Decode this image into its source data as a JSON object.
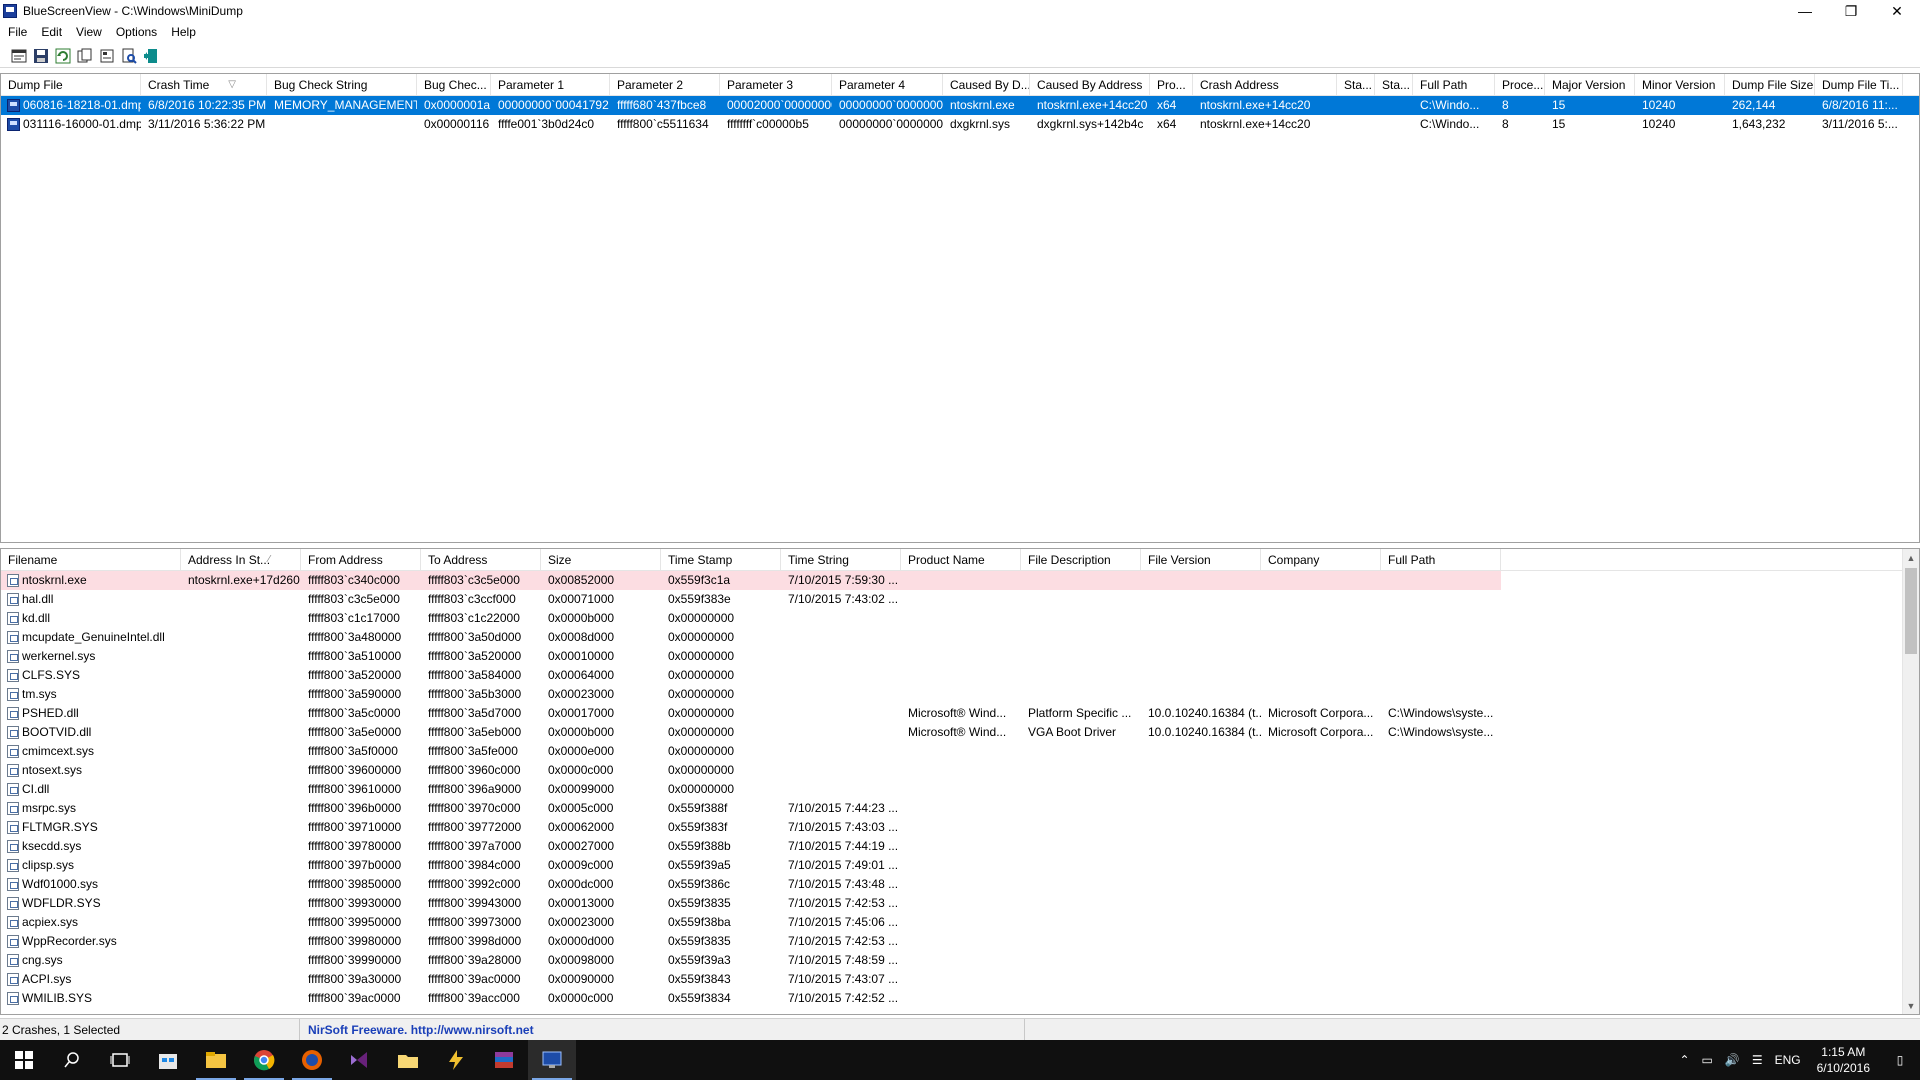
{
  "window": {
    "app_name": "BlueScreenView",
    "path": "C:\\Windows\\MiniDump",
    "controls": {
      "minimize": "—",
      "maximize": "❐",
      "close": "✕"
    }
  },
  "menu": [
    "File",
    "Edit",
    "View",
    "Options",
    "Help"
  ],
  "toolbar_icons": [
    "html-report-icon",
    "save-icon",
    "refresh-icon",
    "copy-icon",
    "properties-icon",
    "find-icon",
    "exit-icon"
  ],
  "crash_table": {
    "columns": [
      {
        "label": "Dump File",
        "w": 140
      },
      {
        "label": "Crash Time",
        "w": 126,
        "sorted": true
      },
      {
        "label": "Bug Check String",
        "w": 150
      },
      {
        "label": "Bug Chec...",
        "w": 74
      },
      {
        "label": "Parameter 1",
        "w": 119
      },
      {
        "label": "Parameter 2",
        "w": 110
      },
      {
        "label": "Parameter 3",
        "w": 112
      },
      {
        "label": "Parameter 4",
        "w": 111
      },
      {
        "label": "Caused By D...",
        "w": 87
      },
      {
        "label": "Caused By Address",
        "w": 120
      },
      {
        "label": "Pro...",
        "w": 43
      },
      {
        "label": "Crash Address",
        "w": 144
      },
      {
        "label": "Sta...",
        "w": 38
      },
      {
        "label": "Sta...",
        "w": 38
      },
      {
        "label": "Full Path",
        "w": 82
      },
      {
        "label": "Proce...",
        "w": 50
      },
      {
        "label": "Major Version",
        "w": 90
      },
      {
        "label": "Minor Version",
        "w": 90
      },
      {
        "label": "Dump File Size",
        "w": 90
      },
      {
        "label": "Dump File Ti...",
        "w": 88
      }
    ],
    "rows": [
      {
        "selected": true,
        "cells": [
          "060816-18218-01.dmp",
          "6/8/2016 10:22:35 PM",
          "MEMORY_MANAGEMENT",
          "0x0000001a",
          "00000000`00041792",
          "fffff680`437fbce8",
          "00002000`00000000",
          "00000000`00000000",
          "ntoskrnl.exe",
          "ntoskrnl.exe+14cc20",
          "x64",
          "ntoskrnl.exe+14cc20",
          "",
          "",
          "C:\\Windo...",
          "8",
          "15",
          "10240",
          "262,144",
          "6/8/2016 11:..."
        ]
      },
      {
        "selected": false,
        "cells": [
          "031116-16000-01.dmp",
          "3/11/2016 5:36:22 PM",
          "",
          "0x00000116",
          "ffffe001`3b0d24c0",
          "fffff800`c5511634",
          "ffffffff`c00000b5",
          "00000000`0000000a",
          "dxgkrnl.sys",
          "dxgkrnl.sys+142b4c",
          "x64",
          "ntoskrnl.exe+14cc20",
          "",
          "",
          "C:\\Windo...",
          "8",
          "15",
          "10240",
          "1,643,232",
          "3/11/2016 5:..."
        ]
      }
    ]
  },
  "module_table": {
    "columns": [
      {
        "label": "Filename",
        "w": 180
      },
      {
        "label": "Address In St...",
        "w": 120,
        "sorted": true
      },
      {
        "label": "From Address",
        "w": 120
      },
      {
        "label": "To Address",
        "w": 120
      },
      {
        "label": "Size",
        "w": 120
      },
      {
        "label": "Time Stamp",
        "w": 120
      },
      {
        "label": "Time String",
        "w": 120
      },
      {
        "label": "Product Name",
        "w": 120
      },
      {
        "label": "File Description",
        "w": 120
      },
      {
        "label": "File Version",
        "w": 120
      },
      {
        "label": "Company",
        "w": 120
      },
      {
        "label": "Full Path",
        "w": 120
      }
    ],
    "rows": [
      {
        "highlight": true,
        "cells": [
          "ntoskrnl.exe",
          "ntoskrnl.exe+17d260",
          "fffff803`c340c000",
          "fffff803`c3c5e000",
          "0x00852000",
          "0x559f3c1a",
          "7/10/2015 7:59:30 ...",
          "",
          "",
          "",
          "",
          ""
        ]
      },
      {
        "cells": [
          "hal.dll",
          "",
          "fffff803`c3c5e000",
          "fffff803`c3ccf000",
          "0x00071000",
          "0x559f383e",
          "7/10/2015 7:43:02 ...",
          "",
          "",
          "",
          "",
          ""
        ]
      },
      {
        "cells": [
          "kd.dll",
          "",
          "fffff803`c1c17000",
          "fffff803`c1c22000",
          "0x0000b000",
          "0x00000000",
          "",
          "",
          "",
          "",
          "",
          ""
        ]
      },
      {
        "cells": [
          "mcupdate_GenuineIntel.dll",
          "",
          "fffff800`3a480000",
          "fffff800`3a50d000",
          "0x0008d000",
          "0x00000000",
          "",
          "",
          "",
          "",
          "",
          ""
        ]
      },
      {
        "cells": [
          "werkernel.sys",
          "",
          "fffff800`3a510000",
          "fffff800`3a520000",
          "0x00010000",
          "0x00000000",
          "",
          "",
          "",
          "",
          "",
          ""
        ]
      },
      {
        "cells": [
          "CLFS.SYS",
          "",
          "fffff800`3a520000",
          "fffff800`3a584000",
          "0x00064000",
          "0x00000000",
          "",
          "",
          "",
          "",
          "",
          ""
        ]
      },
      {
        "cells": [
          "tm.sys",
          "",
          "fffff800`3a590000",
          "fffff800`3a5b3000",
          "0x00023000",
          "0x00000000",
          "",
          "",
          "",
          "",
          "",
          ""
        ]
      },
      {
        "cells": [
          "PSHED.dll",
          "",
          "fffff800`3a5c0000",
          "fffff800`3a5d7000",
          "0x00017000",
          "0x00000000",
          "",
          "Microsoft® Wind...",
          "Platform Specific ...",
          "10.0.10240.16384 (t...",
          "Microsoft Corpora...",
          "C:\\Windows\\syste..."
        ]
      },
      {
        "cells": [
          "BOOTVID.dll",
          "",
          "fffff800`3a5e0000",
          "fffff800`3a5eb000",
          "0x0000b000",
          "0x00000000",
          "",
          "Microsoft® Wind...",
          "VGA Boot Driver",
          "10.0.10240.16384 (t...",
          "Microsoft Corpora...",
          "C:\\Windows\\syste..."
        ]
      },
      {
        "cells": [
          "cmimcext.sys",
          "",
          "fffff800`3a5f0000",
          "fffff800`3a5fe000",
          "0x0000e000",
          "0x00000000",
          "",
          "",
          "",
          "",
          "",
          ""
        ]
      },
      {
        "cells": [
          "ntosext.sys",
          "",
          "fffff800`39600000",
          "fffff800`3960c000",
          "0x0000c000",
          "0x00000000",
          "",
          "",
          "",
          "",
          "",
          ""
        ]
      },
      {
        "cells": [
          "CI.dll",
          "",
          "fffff800`39610000",
          "fffff800`396a9000",
          "0x00099000",
          "0x00000000",
          "",
          "",
          "",
          "",
          "",
          ""
        ]
      },
      {
        "cells": [
          "msrpc.sys",
          "",
          "fffff800`396b0000",
          "fffff800`3970c000",
          "0x0005c000",
          "0x559f388f",
          "7/10/2015 7:44:23 ...",
          "",
          "",
          "",
          "",
          ""
        ]
      },
      {
        "cells": [
          "FLTMGR.SYS",
          "",
          "fffff800`39710000",
          "fffff800`39772000",
          "0x00062000",
          "0x559f383f",
          "7/10/2015 7:43:03 ...",
          "",
          "",
          "",
          "",
          ""
        ]
      },
      {
        "cells": [
          "ksecdd.sys",
          "",
          "fffff800`39780000",
          "fffff800`397a7000",
          "0x00027000",
          "0x559f388b",
          "7/10/2015 7:44:19 ...",
          "",
          "",
          "",
          "",
          ""
        ]
      },
      {
        "cells": [
          "clipsp.sys",
          "",
          "fffff800`397b0000",
          "fffff800`3984c000",
          "0x0009c000",
          "0x559f39a5",
          "7/10/2015 7:49:01 ...",
          "",
          "",
          "",
          "",
          ""
        ]
      },
      {
        "cells": [
          "Wdf01000.sys",
          "",
          "fffff800`39850000",
          "fffff800`3992c000",
          "0x000dc000",
          "0x559f386c",
          "7/10/2015 7:43:48 ...",
          "",
          "",
          "",
          "",
          ""
        ]
      },
      {
        "cells": [
          "WDFLDR.SYS",
          "",
          "fffff800`39930000",
          "fffff800`39943000",
          "0x00013000",
          "0x559f3835",
          "7/10/2015 7:42:53 ...",
          "",
          "",
          "",
          "",
          ""
        ]
      },
      {
        "cells": [
          "acpiex.sys",
          "",
          "fffff800`39950000",
          "fffff800`39973000",
          "0x00023000",
          "0x559f38ba",
          "7/10/2015 7:45:06 ...",
          "",
          "",
          "",
          "",
          ""
        ]
      },
      {
        "cells": [
          "WppRecorder.sys",
          "",
          "fffff800`39980000",
          "fffff800`3998d000",
          "0x0000d000",
          "0x559f3835",
          "7/10/2015 7:42:53 ...",
          "",
          "",
          "",
          "",
          ""
        ]
      },
      {
        "cells": [
          "cng.sys",
          "",
          "fffff800`39990000",
          "fffff800`39a28000",
          "0x00098000",
          "0x559f39a3",
          "7/10/2015 7:48:59 ...",
          "",
          "",
          "",
          "",
          ""
        ]
      },
      {
        "cells": [
          "ACPI.sys",
          "",
          "fffff800`39a30000",
          "fffff800`39ac0000",
          "0x00090000",
          "0x559f3843",
          "7/10/2015 7:43:07 ...",
          "",
          "",
          "",
          "",
          ""
        ]
      },
      {
        "cells": [
          "WMILIB.SYS",
          "",
          "fffff800`39ac0000",
          "fffff800`39acc000",
          "0x0000c000",
          "0x559f3834",
          "7/10/2015 7:42:52 ...",
          "",
          "",
          "",
          "",
          ""
        ]
      }
    ]
  },
  "status": {
    "summary": "2 Crashes, 1 Selected",
    "credit": "NirSoft Freeware.  http://www.nirsoft.net"
  },
  "taskbar": {
    "apps": [
      "start-icon",
      "search-icon",
      "task-view-icon",
      "store-icon",
      "file-explorer-icon",
      "chrome-icon",
      "firefox-icon",
      "visual-studio-icon",
      "folder-icon",
      "lightning-icon",
      "winrar-icon",
      "bluescreenview-icon"
    ],
    "tray": {
      "lang": "ENG",
      "time": "1:15 AM",
      "date": "6/10/2016"
    }
  },
  "colors": {
    "selection": "#0078d7",
    "highlight_row": "#fcdde2",
    "credit_text": "#1a3fb8"
  }
}
